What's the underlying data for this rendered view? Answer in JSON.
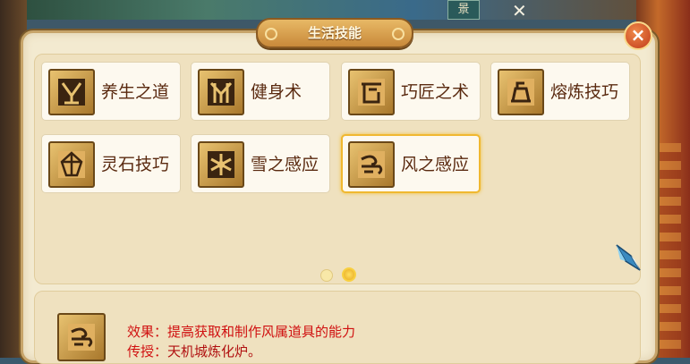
{
  "header": {
    "tag": "景",
    "title": "生活技能"
  },
  "skills": [
    {
      "label": "养生之道",
      "icon": "yangsheng-icon"
    },
    {
      "label": "健身术",
      "icon": "jianshen-icon"
    },
    {
      "label": "巧匠之术",
      "icon": "qiaojiang-icon"
    },
    {
      "label": "熔炼技巧",
      "icon": "ronglian-icon"
    },
    {
      "label": "灵石技巧",
      "icon": "lingshi-icon"
    },
    {
      "label": "雪之感应",
      "icon": "snowflake-icon"
    },
    {
      "label": "风之感应",
      "icon": "wind-icon",
      "selected": true
    }
  ],
  "pagination": {
    "pages": 2,
    "current": 2
  },
  "detail": {
    "effect_label": "效果：",
    "effect_value": "提高获取和制作风属道具的能力",
    "teach_label": "传授：",
    "teach_value": "天机城炼化炉。"
  },
  "colors": {
    "panel_bg": "#f3ead0",
    "selected_border": "#f0b830",
    "detail_text": "#d01010",
    "label_text": "#5a2a10"
  }
}
